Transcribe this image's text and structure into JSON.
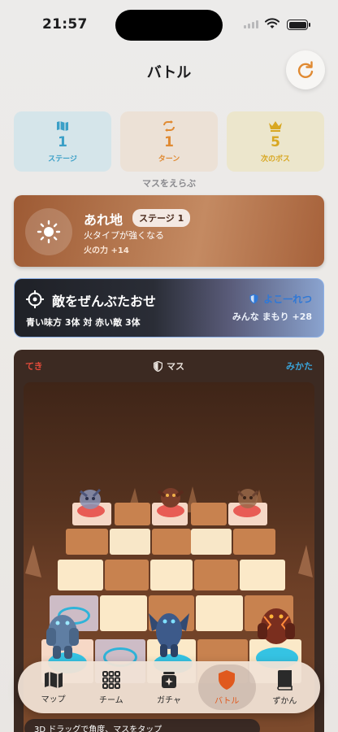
{
  "status": {
    "time": "21:57"
  },
  "header": {
    "title": "バトル"
  },
  "stats": [
    {
      "value": "1",
      "label": "ステージ",
      "icon": "map-icon",
      "color": "#3a9fc7"
    },
    {
      "value": "1",
      "label": "ターン",
      "icon": "repeat-icon",
      "color": "#e08a32"
    },
    {
      "value": "5",
      "label": "次のボス",
      "icon": "crown-icon",
      "color": "#d8a721"
    }
  ],
  "hint": "マスをえらぶ",
  "terrain": {
    "name": "あれ地",
    "stage": "ステージ 1",
    "desc": "火タイプが強くなる",
    "bonus": "火の力 +14",
    "icon": "sun-icon"
  },
  "mission": {
    "title": "敵をぜんぶたおせ",
    "sub": "青い味方 3体 対 赤い敵 3体",
    "formation": "よこ一れつ",
    "formation_bonus": "みんな まもり +28"
  },
  "board": {
    "enemy_label": "てき",
    "grid_label": "マス",
    "ally_label": "みかた"
  },
  "nav": [
    {
      "label": "マップ",
      "icon": "map-icon"
    },
    {
      "label": "チーム",
      "icon": "grid-icon"
    },
    {
      "label": "ガチャ",
      "icon": "gacha-icon"
    },
    {
      "label": "バトル",
      "icon": "shield-icon",
      "active": true
    },
    {
      "label": "ずかん",
      "icon": "book-icon"
    }
  ],
  "tip": "3D ドラッグで角度、マスをタップ"
}
